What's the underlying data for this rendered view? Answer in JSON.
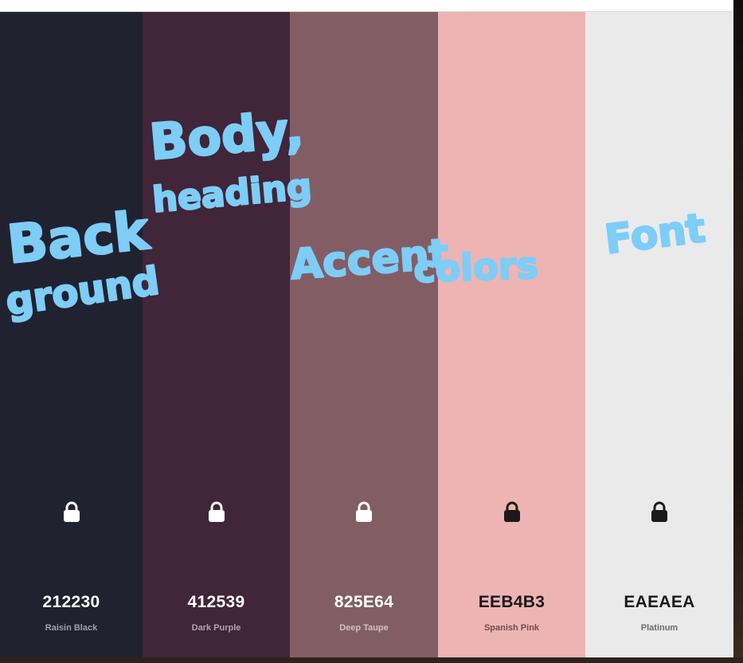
{
  "swatches": [
    {
      "hex": "212230",
      "name": "Raisin Black",
      "color": "#212230",
      "text_color": "#ffffff",
      "name_color": "#9ea0ab",
      "lock_icon": "lock-icon"
    },
    {
      "hex": "412539",
      "name": "Dark Purple",
      "color": "#412539",
      "text_color": "#ffffff",
      "name_color": "#b3a3ae",
      "lock_icon": "lock-icon"
    },
    {
      "hex": "825E64",
      "name": "Deep Taupe",
      "color": "#825E64",
      "text_color": "#ffffff",
      "name_color": "#d2bfc2",
      "lock_icon": "lock-icon"
    },
    {
      "hex": "EEB4B3",
      "name": "Spanish Pink",
      "color": "#EEB4B3",
      "text_color": "#1a1a1a",
      "name_color": "#6e4e4e",
      "lock_icon": "lock-icon"
    },
    {
      "hex": "EAEAEA",
      "name": "Platinum",
      "color": "#EAEAEA",
      "text_color": "#1a1a1a",
      "name_color": "#6b6b6b",
      "lock_icon": "lock-icon"
    }
  ],
  "annotations": {
    "background_line1": "Back",
    "background_line2": "ground",
    "body_line1": "Body,",
    "body_line2": "heading",
    "accent_part1": "Accent",
    "accent_part2": "colors",
    "font": "Font",
    "color": "#7dcdf7"
  }
}
